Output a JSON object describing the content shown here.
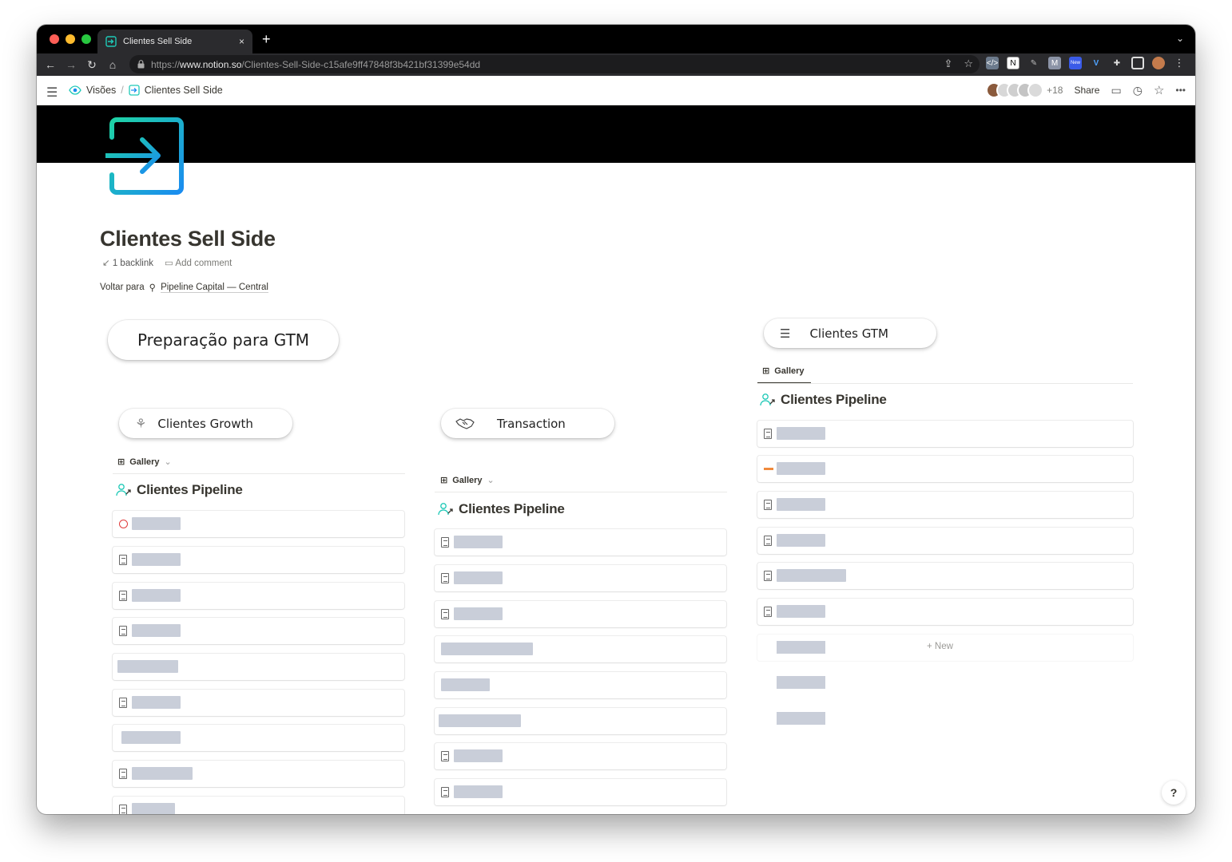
{
  "browser": {
    "tab_title": "Clientes Sell Side",
    "tab_close": "×",
    "new_tab": "+",
    "tab_menu": "⌄",
    "url_prefix": "https://",
    "url_host": "www.notion.so",
    "url_path": "/Clientes-Sell-Side-c15afe9ff47848f3b421bf31399e54dd",
    "ext_new_badge": "New"
  },
  "topbar": {
    "breadcrumb_parent": "Visões",
    "breadcrumb_sep": "/",
    "breadcrumb_current": "Clientes Sell Side",
    "avatar_more": "+18",
    "share_label": "Share",
    "more_label": "•••"
  },
  "page": {
    "title": "Clientes Sell Side",
    "backlinks": "1 backlink",
    "add_comment": "Add comment",
    "voltar_label": "Voltar para",
    "voltar_link": "Pipeline Capital — Central"
  },
  "sections": {
    "gtm_prep": "Preparação para GTM",
    "growth": "Clientes Growth",
    "transaction": "Transaction",
    "gtm": "Clientes GTM"
  },
  "galleries": {
    "growth": {
      "view_label": "Gallery",
      "title": "Clientes Pipeline"
    },
    "transaction": {
      "view_label": "Gallery",
      "title": "Clientes Pipeline"
    },
    "gtm": {
      "view_label": "Gallery",
      "title": "Clientes Pipeline",
      "new_label": "New"
    }
  },
  "help_label": "?",
  "colors": {
    "accent_teal": "#1ec9b7",
    "accent_blue": "#1a8cf0",
    "redacted": "#c9ced9",
    "text": "#37352f"
  }
}
